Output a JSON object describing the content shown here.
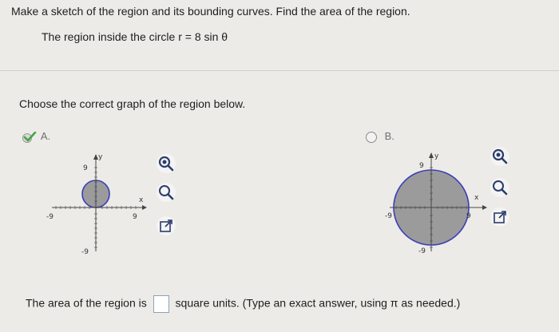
{
  "question": {
    "instruction": "Make a sketch of the region and its bounding curves. Find the area of the region.",
    "region": "The region inside the circle r = 8 sin θ"
  },
  "prompt": {
    "choose": "Choose the correct graph of the region below."
  },
  "options": [
    {
      "label": "A.",
      "selected": true,
      "axis": {
        "y_top": "9",
        "y_bottom": "-9",
        "x_left": "-9",
        "x_right": "9",
        "x_name": "x",
        "y_name": "y"
      }
    },
    {
      "label": "B.",
      "selected": false,
      "axis": {
        "y_top": "9",
        "y_bottom": "-9",
        "x_left": "-9",
        "x_right": "9",
        "x_name": "x",
        "y_name": "y"
      }
    }
  ],
  "answer": {
    "prefix": "The area of the region is",
    "suffix": "square units. (Type an exact answer, using π as needed.)",
    "value": ""
  },
  "colors": {
    "region_fill": "#9b9b9b",
    "circle_stroke": "#3b3fb6",
    "check": "#47a447",
    "zoom_icon": "#2a3d6b"
  },
  "icons": [
    "zoom-in-icon",
    "zoom-out-icon",
    "open-in-new-window-icon"
  ]
}
